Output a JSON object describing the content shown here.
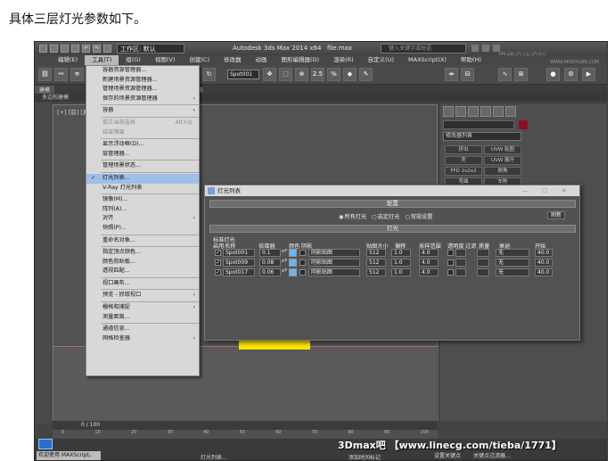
{
  "caption": "具体三层灯光参数如下。",
  "app": {
    "workspace": "工作区: 默认",
    "title": "Autodesk 3ds Max  2014 x64",
    "file": "file.max",
    "search_placeholder": "键入关键字或短语",
    "watermark_top": "思缘设计论坛",
    "watermark_top2": "WWW.MISSYUAN.COM"
  },
  "menubar": [
    "编辑(E)",
    "工具(T)",
    "组(G)",
    "视图(V)",
    "创建(C)",
    "修改器",
    "动画",
    "图形编辑器(D)",
    "渲染(R)",
    "自定义(U)",
    "MAXScript(X)",
    "帮助(H)"
  ],
  "toolbar": {
    "selection_set": "Spot001",
    "num": "2.5"
  },
  "ribbon": {
    "tab1": "建模",
    "tab2": "填充",
    "sub": "多边形建模"
  },
  "viewport": {
    "label": "[+] [前] [真实]"
  },
  "tools_menu": {
    "items": [
      {
        "label": "容器资源管理器...",
        "type": "item"
      },
      {
        "label": "新建场景资源管理器...",
        "type": "item"
      },
      {
        "label": "管理场景资源管理器...",
        "type": "item"
      },
      {
        "label": "保存的场景资源管理器",
        "type": "submenu"
      },
      {
        "type": "sep"
      },
      {
        "label": "容器",
        "type": "submenu"
      },
      {
        "type": "sep"
      },
      {
        "label": "孤立当前选择",
        "shortcut": "Alt+Q",
        "type": "disabled"
      },
      {
        "label": "结束隔离",
        "type": "disabled"
      },
      {
        "type": "sep"
      },
      {
        "label": "显示浮动框(D)...",
        "type": "item"
      },
      {
        "label": "层管理器...",
        "type": "item"
      },
      {
        "type": "sep"
      },
      {
        "label": "管理场景状态...",
        "type": "item"
      },
      {
        "type": "sep"
      },
      {
        "label": "灯光列表...",
        "type": "highlight",
        "checked": true
      },
      {
        "label": "V-Ray 灯光列表",
        "type": "item"
      },
      {
        "type": "sep"
      },
      {
        "label": "镜像(M)...",
        "type": "item"
      },
      {
        "label": "阵列(A)...",
        "type": "item"
      },
      {
        "label": "对齐",
        "type": "submenu"
      },
      {
        "label": "快照(P)...",
        "type": "item"
      },
      {
        "type": "sep"
      },
      {
        "label": "重命名对象...",
        "type": "item"
      },
      {
        "type": "sep"
      },
      {
        "label": "指定顶点颜色...",
        "type": "item"
      },
      {
        "label": "颜色剪贴板...",
        "type": "item"
      },
      {
        "label": "透视匹配...",
        "type": "item"
      },
      {
        "type": "sep"
      },
      {
        "label": "视口画布...",
        "type": "item"
      },
      {
        "type": "sep"
      },
      {
        "label": "预览 - 抓取视口",
        "type": "submenu"
      },
      {
        "type": "sep"
      },
      {
        "label": "栅格和捕捉",
        "type": "submenu"
      },
      {
        "label": "测量距离...",
        "type": "item"
      },
      {
        "type": "sep"
      },
      {
        "label": "通道信息...",
        "type": "item"
      },
      {
        "label": "网格检查器",
        "type": "submenu"
      }
    ]
  },
  "light_lister": {
    "title": "灯光列表",
    "config_rollout": "配置",
    "radios": [
      {
        "label": "所有灯光",
        "on": true
      },
      {
        "label": "选定灯光",
        "on": false
      },
      {
        "label": "常规设置",
        "on": false
      }
    ],
    "refresh": "刷新",
    "lights_rollout": "灯光",
    "group_label": "标准灯光",
    "headers": [
      "启用",
      "名称",
      "倍增器",
      "颜色",
      "阴影",
      "贴图大小",
      "偏移",
      "采样范围",
      "透明度",
      "过滤",
      "质量",
      "衰退",
      "开始"
    ],
    "rows": [
      {
        "enabled": true,
        "name": "Spot001",
        "multiplier": "0.1",
        "shadow": "阴影贴图",
        "map_size": "512",
        "bias": "1.0",
        "sample_range": "4.0",
        "decay": "无",
        "start": "40.0"
      },
      {
        "enabled": true,
        "name": "Spot009",
        "multiplier": "0.08",
        "shadow": "阴影贴图",
        "map_size": "512",
        "bias": "1.0",
        "sample_range": "4.0",
        "decay": "无",
        "start": "40.0"
      },
      {
        "enabled": true,
        "name": "Spot017",
        "multiplier": "0.06",
        "shadow": "阴影贴图",
        "map_size": "512",
        "bias": "1.0",
        "sample_range": "4.0",
        "decay": "无",
        "start": "40.0"
      }
    ],
    "light_color": "#6ab4ef"
  },
  "command_panel": {
    "modifier_list": "修改器列表",
    "buttons": [
      "挤出",
      "UVW 贴图",
      "壳",
      "UVW 展开",
      "FFD 2x2x2",
      "倒角",
      "弯曲",
      "车削"
    ]
  },
  "timeline": {
    "slider": "0 / 100",
    "ticks": [
      "0",
      "10",
      "20",
      "30",
      "40",
      "50",
      "60",
      "70",
      "80",
      "90",
      "100"
    ]
  },
  "status": {
    "maxscript": "欢迎使用 MAXScript。",
    "light_list": "灯光列表...",
    "add_time_tag": "添加时间标记",
    "set_key": "设置关键点",
    "key_filter": "关键点过滤器..."
  },
  "watermark_bottom": "3Dmax吧 【www.linecg.com/tieba/1771】"
}
